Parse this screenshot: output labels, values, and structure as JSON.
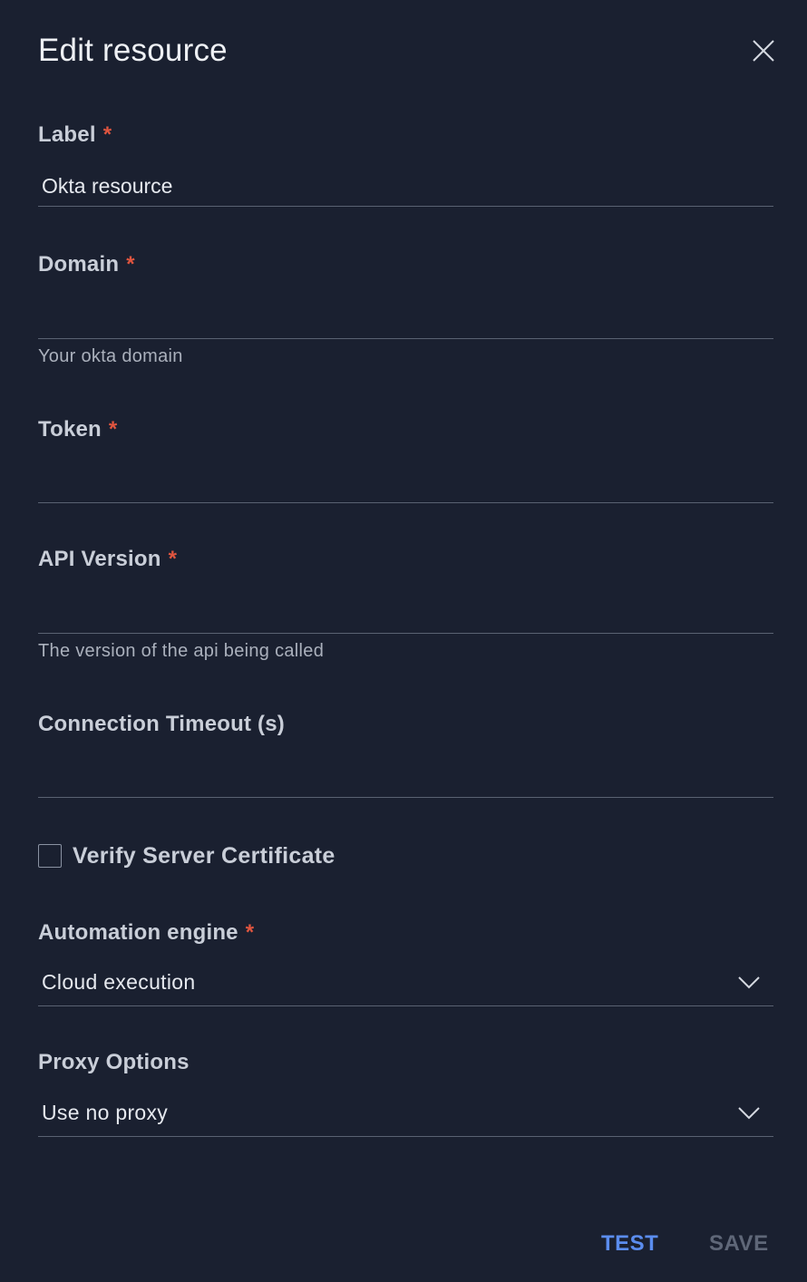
{
  "dialog": {
    "title": "Edit resource",
    "close_label": "Close"
  },
  "required_marker": "*",
  "fields": {
    "label": {
      "label": "Label",
      "value": "Okta resource",
      "required": true
    },
    "domain": {
      "label": "Domain",
      "value": "",
      "helper": "Your okta domain",
      "required": true
    },
    "token": {
      "label": "Token",
      "value": "",
      "required": true
    },
    "api_version": {
      "label": "API Version",
      "value": "",
      "helper": "The version of the api being called",
      "required": true
    },
    "connection_timeout": {
      "label": "Connection Timeout (s)",
      "value": "",
      "required": false
    }
  },
  "verify_certificate": {
    "label": "Verify Server Certificate",
    "checked": false
  },
  "automation_engine": {
    "label": "Automation engine",
    "value": "Cloud execution",
    "required": true
  },
  "proxy_options": {
    "label": "Proxy Options",
    "value": "Use no proxy",
    "required": false
  },
  "actions": {
    "test_label": "TEST",
    "save_label": "SAVE"
  },
  "colors": {
    "background": "#1a2030",
    "required": "#e0553f",
    "accent": "#5b8def",
    "disabled": "#5f6778"
  },
  "icons": {
    "close": "close-icon",
    "dropdown": "chevron-down-icon"
  }
}
